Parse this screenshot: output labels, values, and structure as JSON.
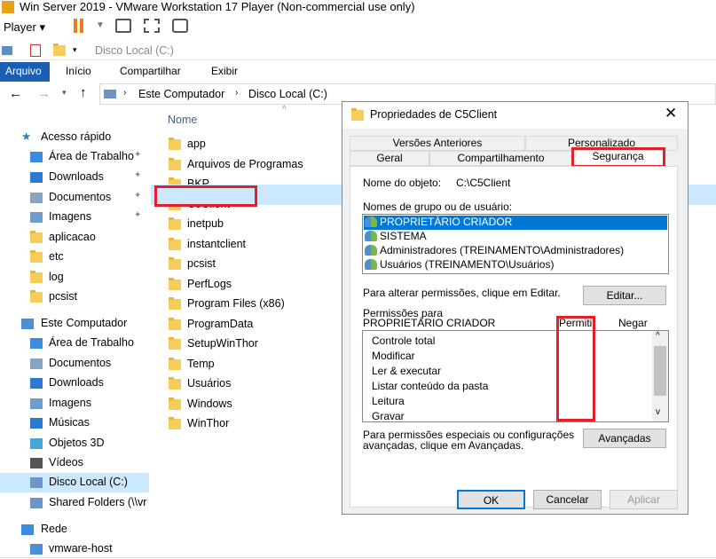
{
  "window": {
    "title": "Win Server 2019 - VMware Workstation 17 Player (Non-commercial use only)"
  },
  "player": {
    "menu_label": "Player"
  },
  "explorer": {
    "qa_path": "Disco Local (C:)",
    "ribbon_tabs": [
      "Arquivo",
      "Início",
      "Compartilhar",
      "Exibir"
    ],
    "address": {
      "segments": [
        "Este Computador",
        "Disco Local (C:)"
      ]
    },
    "column_header": "Nome",
    "nav": [
      {
        "label": "Acesso rápido",
        "icon": "star-icon"
      },
      {
        "label": "Área de Trabalho",
        "icon": "desktop-icon",
        "pinned": true
      },
      {
        "label": "Downloads",
        "icon": "download-icon",
        "pinned": true
      },
      {
        "label": "Documentos",
        "icon": "document-icon",
        "pinned": true
      },
      {
        "label": "Imagens",
        "icon": "image-icon",
        "pinned": true
      },
      {
        "label": "aplicacao",
        "icon": "folder-icon"
      },
      {
        "label": "etc",
        "icon": "folder-icon"
      },
      {
        "label": "log",
        "icon": "folder-icon"
      },
      {
        "label": "pcsist",
        "icon": "folder-icon"
      },
      {
        "label": "Este Computador",
        "icon": "computer-icon"
      },
      {
        "label": "Área de Trabalho",
        "icon": "desktop-icon"
      },
      {
        "label": "Documentos",
        "icon": "document-icon"
      },
      {
        "label": "Downloads",
        "icon": "download-icon"
      },
      {
        "label": "Imagens",
        "icon": "image-icon"
      },
      {
        "label": "Músicas",
        "icon": "music-icon"
      },
      {
        "label": "Objetos 3D",
        "icon": "cube-icon"
      },
      {
        "label": "Vídeos",
        "icon": "video-icon"
      },
      {
        "label": "Disco Local (C:)",
        "icon": "drive-icon",
        "selected": true
      },
      {
        "label": "Shared Folders (\\\\vr",
        "icon": "network-drive-icon"
      },
      {
        "label": "Rede",
        "icon": "network-icon"
      },
      {
        "label": "vmware-host",
        "icon": "computer-icon"
      }
    ],
    "files": [
      "app",
      "Arquivos de Programas",
      "BKP",
      "C5Client",
      "inetpub",
      "instantclient",
      "pcsist",
      "PerfLogs",
      "Program Files (x86)",
      "ProgramData",
      "SetupWinThor",
      "Temp",
      "Usuários",
      "Windows",
      "WinThor"
    ]
  },
  "dialog": {
    "title": "Propriedades de C5Client",
    "tabs_top": [
      "Versões Anteriores",
      "Personalizado"
    ],
    "tabs_bottom": [
      "Geral",
      "Compartilhamento",
      "Segurança"
    ],
    "object_label": "Nome do objeto:",
    "object_value": "C:\\C5Client",
    "groups_label": "Nomes de grupo ou de usuário:",
    "groups": [
      "PROPRIETÁRIO CRIADOR",
      "SISTEMA",
      "Administradores (TREINAMENTO\\Administradores)",
      "Usuários (TREINAMENTO\\Usuários)"
    ],
    "edit_hint": "Para alterar permissões, clique em Editar.",
    "edit_button": "Editar...",
    "perms_label_1": "Permissões para",
    "perms_label_2": "PROPRIETÁRIO CRIADOR",
    "col_allow": "Permitir",
    "col_deny": "Negar",
    "permissions": [
      "Controle total",
      "Modificar",
      "Ler & executar",
      "Listar conteúdo da pasta",
      "Leitura",
      "Gravar"
    ],
    "special_hint_1": "Para permissões especiais ou configurações",
    "special_hint_2": "avançadas, clique em Avançadas.",
    "advanced_button": "Avançadas",
    "ok_button": "OK",
    "cancel_button": "Cancelar",
    "apply_button": "Aplicar"
  },
  "colors": {
    "highlight": "#e2202a",
    "selection": "#0078d7",
    "ribbon_file": "#1a5fb4"
  }
}
